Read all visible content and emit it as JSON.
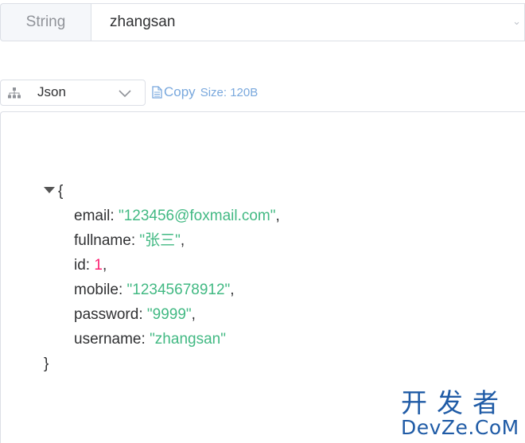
{
  "key": {
    "type_label": "String",
    "value": "zhangsan"
  },
  "toolbar": {
    "format": "Json",
    "copy_label": "Copy",
    "size_label": "Size: 120B"
  },
  "json_view": {
    "open_brace": "{",
    "close_brace": "}",
    "fields": [
      {
        "key": "email",
        "value": "\"123456@foxmail.com\"",
        "kind": "string",
        "comma": ","
      },
      {
        "key": "fullname",
        "value": "\"张三\"",
        "kind": "string",
        "comma": ","
      },
      {
        "key": "id",
        "value": "1",
        "kind": "number",
        "comma": ","
      },
      {
        "key": "mobile",
        "value": "\"12345678912\"",
        "kind": "string",
        "comma": ","
      },
      {
        "key": "password",
        "value": "\"9999\"",
        "kind": "string",
        "comma": ","
      },
      {
        "key": "username",
        "value": "\"zhangsan\"",
        "kind": "string",
        "comma": ""
      }
    ]
  },
  "watermark": {
    "cn": "开发者",
    "en": "DevZe.CoM"
  },
  "colors": {
    "string": "#42b983",
    "number": "#fc1e70",
    "link": "#79a8dd",
    "watermark": "#1f5ba6"
  },
  "icons": [
    "tree-icon",
    "chevron-down-icon",
    "document-icon",
    "caret-down-icon"
  ]
}
